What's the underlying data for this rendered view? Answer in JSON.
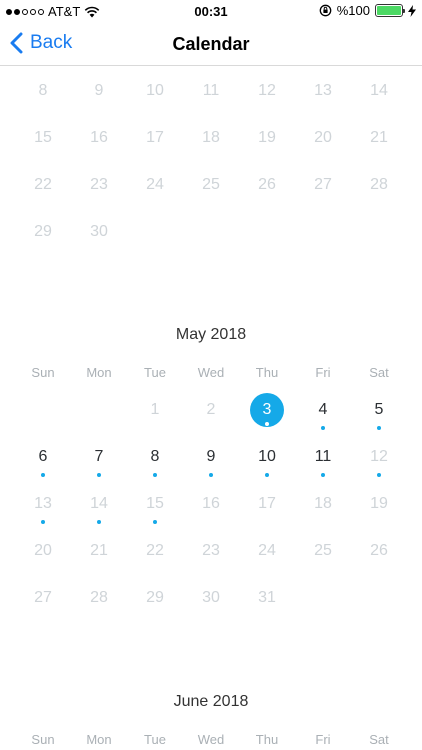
{
  "status_bar": {
    "carrier": "AT&T",
    "time": "00:31",
    "battery": "%100",
    "battery_level": 1.0,
    "signal_bars_filled": 2,
    "signal_bars_total": 5
  },
  "nav": {
    "back_label": "Back",
    "title": "Calendar"
  },
  "colors": {
    "accent": "#15a9e8",
    "link": "#1a7cf0"
  },
  "april_partial": {
    "weeks": [
      [
        "8",
        "9",
        "10",
        "11",
        "12",
        "13",
        "14"
      ],
      [
        "15",
        "16",
        "17",
        "18",
        "19",
        "20",
        "21"
      ],
      [
        "22",
        "23",
        "24",
        "25",
        "26",
        "27",
        "28"
      ],
      [
        "29",
        "30",
        "",
        "",
        "",
        "",
        ""
      ]
    ]
  },
  "may": {
    "title": "May 2018",
    "weekdays": [
      "Sun",
      "Mon",
      "Tue",
      "Wed",
      "Thu",
      "Fri",
      "Sat"
    ],
    "selected_day": "3",
    "weeks": [
      [
        "",
        "",
        "1",
        "2",
        "3",
        "4",
        "5"
      ],
      [
        "6",
        "7",
        "8",
        "9",
        "10",
        "11",
        "12"
      ],
      [
        "13",
        "14",
        "15",
        "16",
        "17",
        "18",
        "19"
      ],
      [
        "20",
        "21",
        "22",
        "23",
        "24",
        "25",
        "26"
      ],
      [
        "27",
        "28",
        "29",
        "30",
        "31",
        "",
        ""
      ]
    ],
    "active_days": [
      "3",
      "4",
      "5",
      "6",
      "7",
      "8",
      "9",
      "10",
      "11"
    ],
    "event_days": [
      "3",
      "4",
      "5",
      "6",
      "7",
      "8",
      "9",
      "10",
      "11",
      "12",
      "13",
      "14",
      "15"
    ]
  },
  "june": {
    "title": "June 2018",
    "weekdays": [
      "Sun",
      "Mon",
      "Tue",
      "Wed",
      "Thu",
      "Fri",
      "Sat"
    ]
  }
}
